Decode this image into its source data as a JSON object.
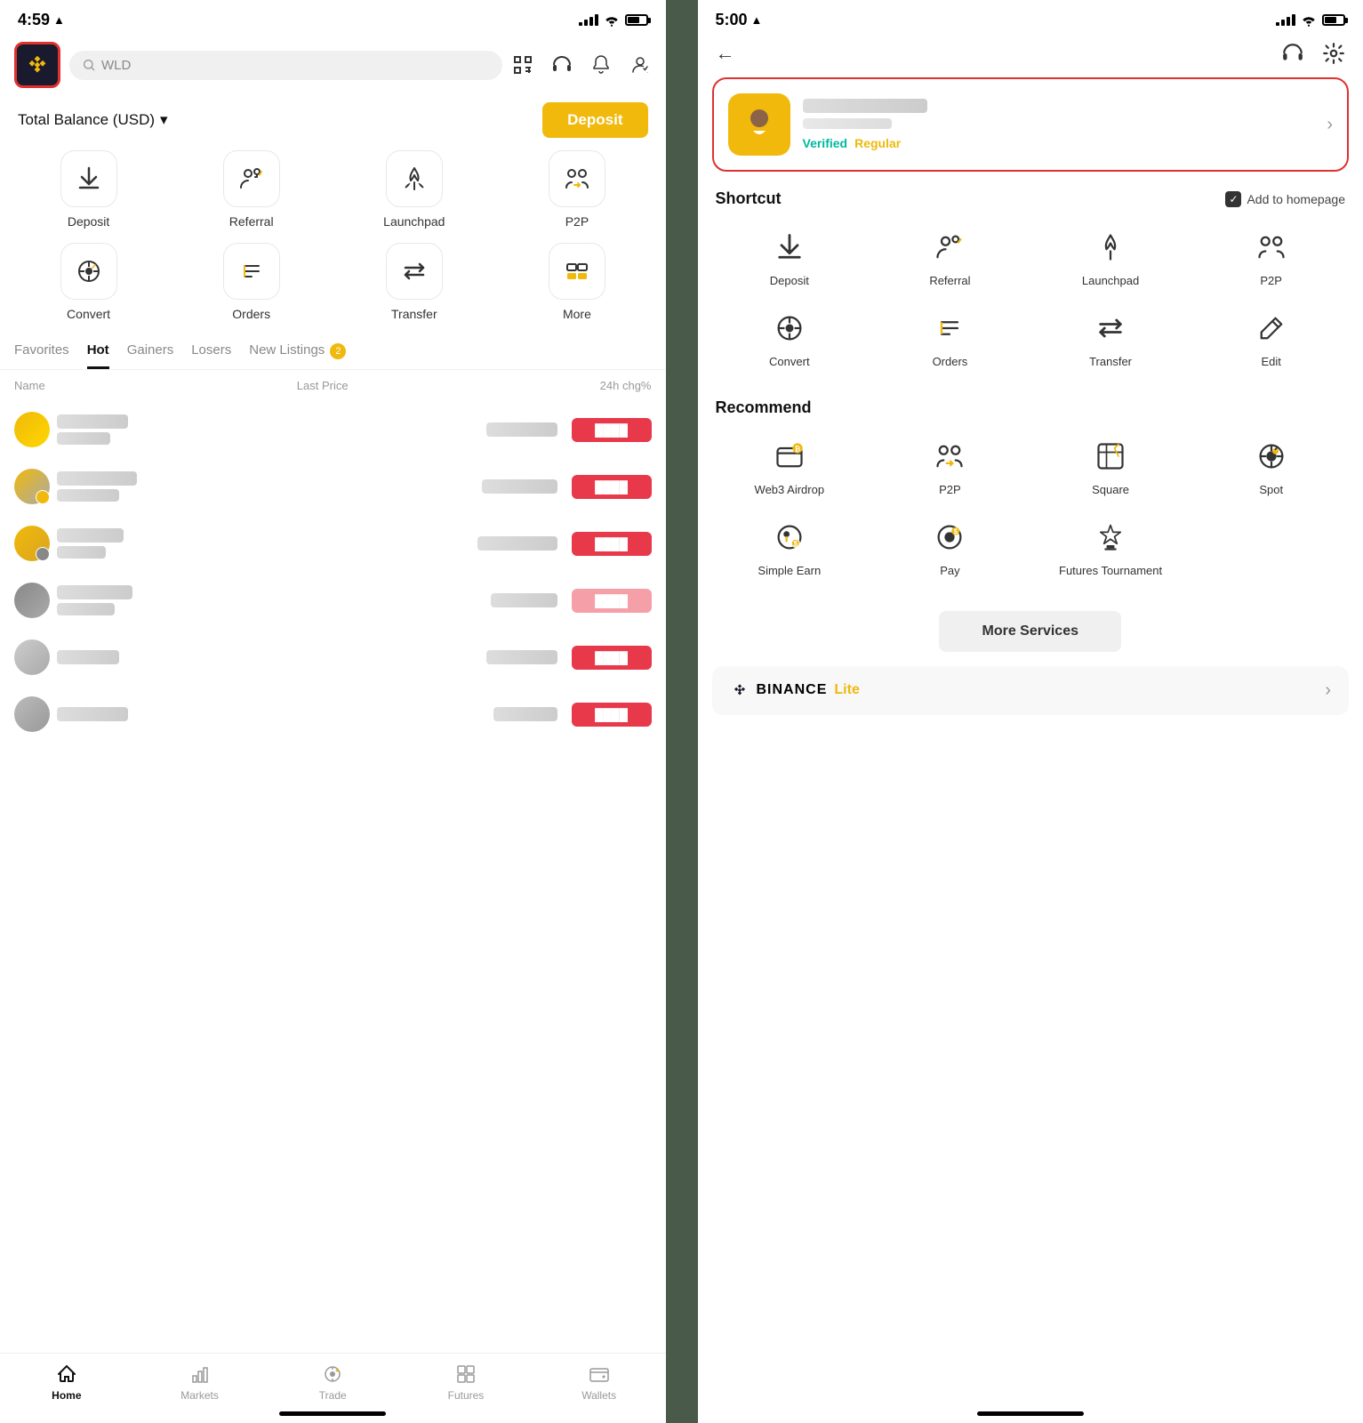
{
  "phone1": {
    "status_time": "4:59",
    "status_arrow": "▲",
    "search_placeholder": "WLD",
    "balance_label": "Total Balance (USD)",
    "deposit_btn": "Deposit",
    "actions": [
      {
        "label": "Deposit",
        "icon": "deposit"
      },
      {
        "label": "Referral",
        "icon": "referral"
      },
      {
        "label": "Launchpad",
        "icon": "launchpad"
      },
      {
        "label": "P2P",
        "icon": "p2p"
      },
      {
        "label": "Convert",
        "icon": "convert"
      },
      {
        "label": "Orders",
        "icon": "orders"
      },
      {
        "label": "Transfer",
        "icon": "transfer"
      },
      {
        "label": "More",
        "icon": "more"
      }
    ],
    "tabs": [
      "Favorites",
      "Hot",
      "Gainers",
      "Losers",
      "New Listings"
    ],
    "active_tab": "Hot",
    "new_listings_badge": "2",
    "market_cols": [
      "Name",
      "Last Price",
      "24h chg%"
    ],
    "nav": [
      "Home",
      "Markets",
      "Trade",
      "Futures",
      "Wallets"
    ],
    "active_nav": "Home"
  },
  "phone2": {
    "status_time": "5:00",
    "status_arrow": "▲",
    "verified_label": "Verified",
    "regular_label": "Regular",
    "shortcut_title": "Shortcut",
    "add_homepage_label": "Add to homepage",
    "shortcut_items": [
      {
        "label": "Deposit",
        "icon": "deposit"
      },
      {
        "label": "Referral",
        "icon": "referral"
      },
      {
        "label": "Launchpad",
        "icon": "launchpad"
      },
      {
        "label": "P2P",
        "icon": "p2p"
      },
      {
        "label": "Convert",
        "icon": "convert"
      },
      {
        "label": "Orders",
        "icon": "orders"
      },
      {
        "label": "Transfer",
        "icon": "transfer"
      },
      {
        "label": "Edit",
        "icon": "edit"
      }
    ],
    "recommend_title": "Recommend",
    "recommend_items": [
      {
        "label": "Web3 Airdrop",
        "icon": "web3airdrop"
      },
      {
        "label": "P2P",
        "icon": "p2p"
      },
      {
        "label": "Square",
        "icon": "square"
      },
      {
        "label": "Spot",
        "icon": "spot"
      },
      {
        "label": "Simple Earn",
        "icon": "simpleearn"
      },
      {
        "label": "Pay",
        "icon": "pay"
      },
      {
        "label": "Futures Tournament",
        "icon": "futures"
      }
    ],
    "more_services_label": "More Services",
    "binance_lite_label": "BINANCE",
    "binance_lite_suffix": "Lite"
  }
}
